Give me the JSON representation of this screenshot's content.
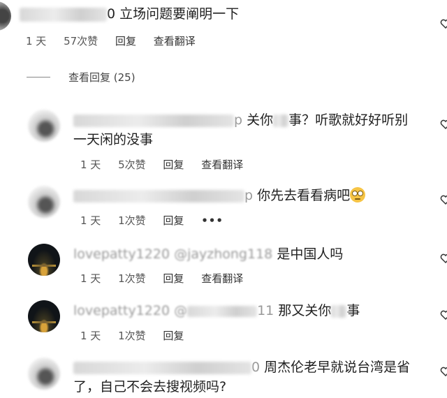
{
  "top_comment": {
    "text": "0 立场问题要阐明一下",
    "time": "1 天",
    "likes": "57次赞",
    "reply": "回复",
    "translate": "查看翻译",
    "view_replies": "查看回复 (25)"
  },
  "replies": [
    {
      "handle_tail": "p",
      "text_a": "关你",
      "text_b": "事？听歌就好好听别",
      "text_line2": "一天闲的没事",
      "time": "1 天",
      "likes": "5次赞",
      "reply": "回复",
      "translate": "查看翻译",
      "avatar": "blurry-portrait"
    },
    {
      "handle_tail": "p",
      "text": "你先去看看病吧",
      "emoji": "face-with-rolling-eyes",
      "time": "1 天",
      "likes": "1次赞",
      "reply": "回复",
      "more": "•••",
      "avatar": "blurry-portrait"
    },
    {
      "handle_visible": "lovepatty1220 @jayzhong118",
      "text": "是中国人吗",
      "time": "1 天",
      "likes": "1次赞",
      "reply": "回复",
      "translate": "查看翻译",
      "avatar": "night-city"
    },
    {
      "handle_visible": "lovepatty1220 @",
      "handle_tail": "11",
      "text_a": "那又关你",
      "text_b": "事",
      "time": "1 天",
      "likes": "1次赞",
      "reply": "回复",
      "avatar": "night-city"
    },
    {
      "handle_tail": "0",
      "text": "周杰伦老早就说台湾是省",
      "text_line2": "了，自己不会去搜视频吗?",
      "avatar": "blurry-portrait"
    }
  ],
  "icons": {
    "like": "heart-outline-icon"
  }
}
